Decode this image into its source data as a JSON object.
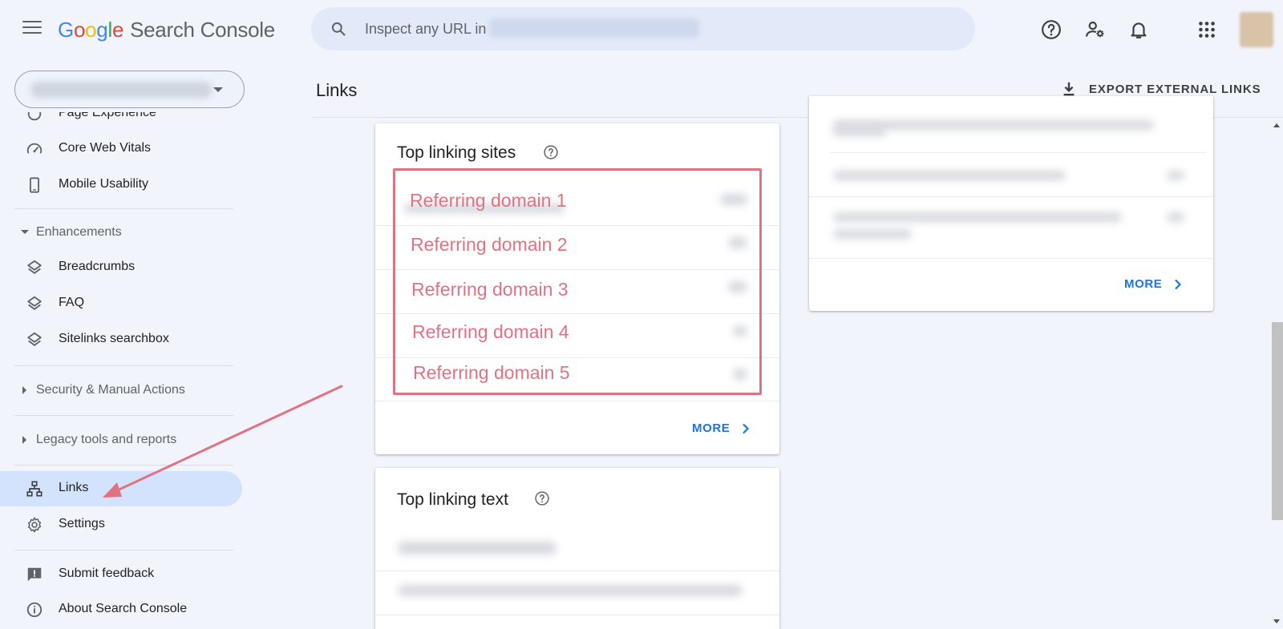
{
  "header": {
    "logo_google": [
      "G",
      "o",
      "o",
      "g",
      "l",
      "e"
    ],
    "logo_product": "Search Console",
    "search_placeholder": "Inspect any URL in"
  },
  "page": {
    "title": "Links",
    "export_label": "EXPORT EXTERNAL LINKS"
  },
  "sidebar": {
    "items_top": [
      {
        "label": "Page Experience",
        "icon": "page-experience-icon"
      },
      {
        "label": "Core Web Vitals",
        "icon": "speedometer-icon"
      },
      {
        "label": "Mobile Usability",
        "icon": "phone-icon"
      }
    ],
    "enhancements": {
      "label": "Enhancements",
      "items": [
        {
          "label": "Breadcrumbs",
          "icon": "layers-icon"
        },
        {
          "label": "FAQ",
          "icon": "layers-icon"
        },
        {
          "label": "Sitelinks searchbox",
          "icon": "layers-icon"
        }
      ]
    },
    "security_label": "Security & Manual Actions",
    "legacy_label": "Legacy tools and reports",
    "links_label": "Links",
    "settings_label": "Settings",
    "feedback_label": "Submit feedback",
    "about_label": "About Search Console"
  },
  "top_linking_sites": {
    "title": "Top linking sites",
    "more_label": "MORE",
    "domains": [
      "Referring domain 1",
      "Referring domain 2",
      "Referring domain 3",
      "Referring domain 4",
      "Referring domain 5"
    ]
  },
  "top_linking_text": {
    "title": "Top linking text"
  },
  "right_card": {
    "more_label": "MORE"
  },
  "colors": {
    "accent": "#1a73e8",
    "annotation": "#e07282",
    "active_nav": "#d3e3fd",
    "background": "#f1f4fb"
  }
}
